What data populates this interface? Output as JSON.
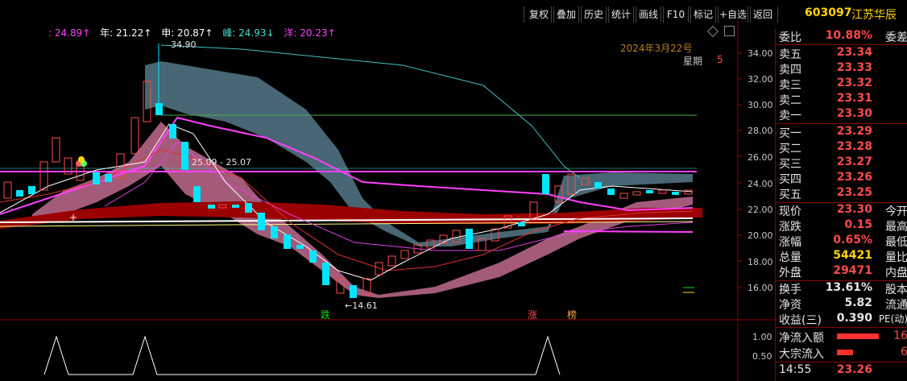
{
  "toolbar": {
    "buttons": [
      "复权",
      "叠加",
      "历史",
      "统计",
      "画线",
      "F10",
      "标记",
      "+自选",
      "返回"
    ]
  },
  "stock": {
    "code": "603097",
    "name": "江苏华辰"
  },
  "info_bar": {
    "items": [
      {
        "text": ": 24.89↑",
        "color": "#ff40ff"
      },
      {
        "text": "年: 21.22↑",
        "color": "#ffffff"
      },
      {
        "text": "申: 20.87↑",
        "color": "#ffffff"
      },
      {
        "text": "峰: 24.93↓",
        "color": "#40e0d0"
      },
      {
        "text": "洋: 20.23↑",
        "color": "#ff40ff"
      }
    ]
  },
  "date_label": "2024年3月22号",
  "weekday_label": "星期",
  "weekday_value": "5",
  "y_axis": [
    "34.00",
    "32.00",
    "30.00",
    "28.00",
    "26.00",
    "24.00",
    "22.00",
    "20.00",
    "18.00",
    "16.00"
  ],
  "sub_axis": [
    "1.00",
    "0.50"
  ],
  "annotations": {
    "high": "34.90",
    "low": "←14.61",
    "range": "25.09 - 25.07",
    "plus": "+",
    "tag_die": "跌",
    "tag_zhang": "涨",
    "tag_bang": "榜"
  },
  "panel": {
    "weibi": {
      "label": "委比",
      "value": "10.88%",
      "label2": "委差"
    },
    "sells": [
      {
        "label": "卖五",
        "value": "23.34"
      },
      {
        "label": "卖四",
        "value": "23.33"
      },
      {
        "label": "卖三",
        "value": "23.32"
      },
      {
        "label": "卖二",
        "value": "23.31"
      },
      {
        "label": "卖一",
        "value": "23.30"
      }
    ],
    "buys": [
      {
        "label": "买一",
        "value": "23.29"
      },
      {
        "label": "买二",
        "value": "23.28"
      },
      {
        "label": "买三",
        "value": "23.27"
      },
      {
        "label": "买四",
        "value": "23.26"
      },
      {
        "label": "买五",
        "value": "23.25"
      }
    ],
    "stats": [
      {
        "label": "现价",
        "value": "23.30",
        "label2": "今开",
        "color": "red"
      },
      {
        "label": "涨跌",
        "value": "0.15",
        "label2": "最高",
        "color": "red"
      },
      {
        "label": "涨幅",
        "value": "0.65%",
        "label2": "最低",
        "color": "red"
      },
      {
        "label": "总量",
        "value": "54421",
        "label2": "量比",
        "color": "yellow"
      },
      {
        "label": "外盘",
        "value": "29471",
        "label2": "内盘",
        "color": "red"
      }
    ],
    "stats2": [
      {
        "label": "换手",
        "value": "13.61%",
        "label2": "股本",
        "color": "white"
      },
      {
        "label": "净资",
        "value": "5.82",
        "label2": "流通",
        "color": "white"
      },
      {
        "label": "收益(三)",
        "value": "0.390",
        "label2": "PE(动)",
        "color": "white"
      }
    ],
    "flows": [
      {
        "label": "净流入额",
        "value": "16"
      },
      {
        "label": "大宗流入",
        "value": "6"
      }
    ],
    "tick": {
      "time": "14:55",
      "price": "23.26"
    }
  }
}
